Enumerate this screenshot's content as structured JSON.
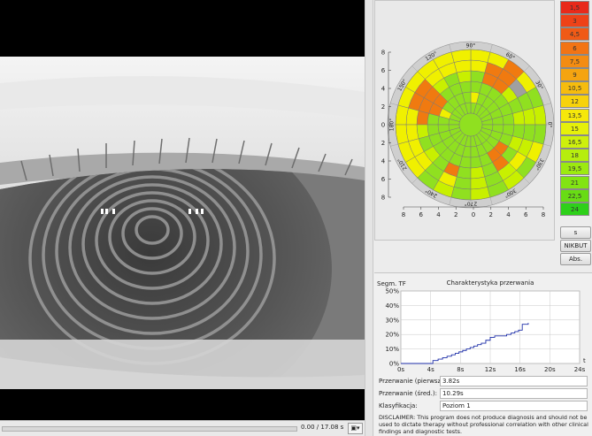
{
  "video": {
    "time_readout": "0.00 / 17.08 s",
    "menu_button_label": "▣▾",
    "progress_fraction": 0.0
  },
  "polar_map": {
    "angle_labels": [
      "0°",
      "30°",
      "60°",
      "90°",
      "120°",
      "150°",
      "180°",
      "210°",
      "240°",
      "270°",
      "300°",
      "330°"
    ],
    "y_axis_ticks": [
      "8",
      "6",
      "4",
      "2",
      "0",
      "2",
      "4",
      "6",
      "8"
    ],
    "x_axis_ticks": [
      "8",
      "6",
      "4",
      "2",
      "0",
      "2",
      "4",
      "6",
      "8"
    ],
    "ring_count": 6,
    "sector_count": 24,
    "colors": {
      "red": "#e53020",
      "orange": "#f07a10",
      "yellow": "#f0f000",
      "yellowgreen": "#c8f000",
      "lime": "#90e020",
      "grey": "#a0a0a0"
    }
  },
  "scale": {
    "values": [
      "1,5",
      "3",
      "4,5",
      "6",
      "7,5",
      "9",
      "10,5",
      "12",
      "13,5",
      "15",
      "16,5",
      "18",
      "19,5",
      "21",
      "22,5",
      "24"
    ],
    "colors": [
      "#e82a1a",
      "#ee4218",
      "#f05a16",
      "#f27414",
      "#f48c12",
      "#f5a410",
      "#f6bc0e",
      "#f7d20c",
      "#f6e80a",
      "#e6f00a",
      "#cef00c",
      "#b6ee0e",
      "#9cea10",
      "#82e412",
      "#68dc14",
      "#2ed01a"
    ],
    "buttons": [
      "s",
      "NIKBUT",
      "Abs."
    ]
  },
  "break_chart": {
    "title": "Charakterystyka przerwania",
    "y_label": "Segm. TF",
    "x_unit": "t",
    "y_ticks": [
      "50%",
      "40%",
      "30%",
      "20%",
      "10%",
      "0%"
    ],
    "x_ticks": [
      "0s",
      "4s",
      "8s",
      "12s",
      "16s",
      "20s",
      "24s"
    ],
    "chart_data": {
      "type": "line",
      "x": [
        0,
        3.8,
        4.3,
        5.0,
        5.6,
        6.2,
        6.8,
        7.3,
        7.8,
        8.3,
        8.8,
        9.3,
        9.8,
        10.3,
        10.8,
        11.4,
        12.0,
        12.6,
        13.2,
        13.7,
        14.2,
        14.8,
        15.3,
        15.8,
        16.3,
        17.1
      ],
      "y": [
        0,
        0,
        2,
        3,
        4,
        5,
        6,
        7,
        8,
        9,
        10,
        11,
        12,
        13,
        14,
        16,
        18,
        19,
        19,
        19,
        20,
        21,
        22,
        23,
        27,
        28
      ],
      "xlim": [
        0,
        24
      ],
      "ylim": [
        0,
        50
      ]
    }
  },
  "fields": {
    "first_break_label": "Przerwanie (pierwsze):",
    "first_break_value": "3.82s",
    "mean_break_label": "Przerwanie (śred.):",
    "mean_break_value": "10.29s",
    "classification_label": "Klasyfikacja:",
    "classification_value": "Poziom 1"
  },
  "disclaimer": "DISCLAIMER: This program does not produce diagnosis and should not be used to dictate therapy without professional correlation with other clinical findings and diagnostic tests."
}
